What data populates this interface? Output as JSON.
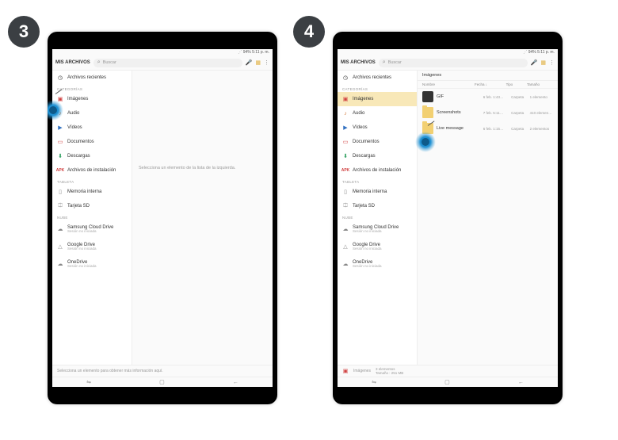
{
  "steps": {
    "left": "3",
    "right": "4"
  },
  "status": {
    "time": "5:11 p. m.",
    "battery": "94%"
  },
  "topbar": {
    "title": "MIS ARCHIVOS",
    "search_placeholder": "Buscar"
  },
  "sidebar": {
    "recent": "Archivos recientes",
    "cat_header": "CATEGORÍAS",
    "images": "Imágenes",
    "audio": "Audio",
    "videos": "Vídeos",
    "documents": "Documentos",
    "downloads": "Descargas",
    "apk_label": "APK",
    "apk": "Archivos de instalación",
    "tablet_header": "TABLETA",
    "internal": "Memoria interna",
    "sd": "Tarjeta SD",
    "cloud_header": "NUBE",
    "samsung": "Samsung Cloud Drive",
    "google": "Google Drive",
    "onedrive": "OneDrive",
    "not_signed": "Sesión no iniciada"
  },
  "main_left": {
    "placeholder": "Selecciona un elemento de la lista de la izquierda."
  },
  "main_right": {
    "crumb": "Imágenes",
    "cols": {
      "name": "Nombre",
      "date": "Fecha",
      "type": "Tipo",
      "size": "Tamaño"
    },
    "rows": [
      {
        "name": "GIF",
        "date": "6 feb. 1:43…",
        "type": "Carpeta",
        "size": "1 elemento",
        "thumb": "img"
      },
      {
        "name": "Screenshots",
        "date": "7 feb. 5:11…",
        "type": "Carpeta",
        "size": "410 elemen…",
        "thumb": "folder"
      },
      {
        "name": "Live message",
        "date": "6 feb. 1:15…",
        "type": "Carpeta",
        "size": "2 elementos",
        "thumb": "folder"
      }
    ]
  },
  "footer_left": "Selecciona un elemento para obtener más información aquí.",
  "footer_right": {
    "label": "Imágenes",
    "count": "3 elementos",
    "size": "Tamaño : 251 MB"
  },
  "colors": {
    "accent": "#f8e8b8",
    "tap": "#1e90d2"
  }
}
